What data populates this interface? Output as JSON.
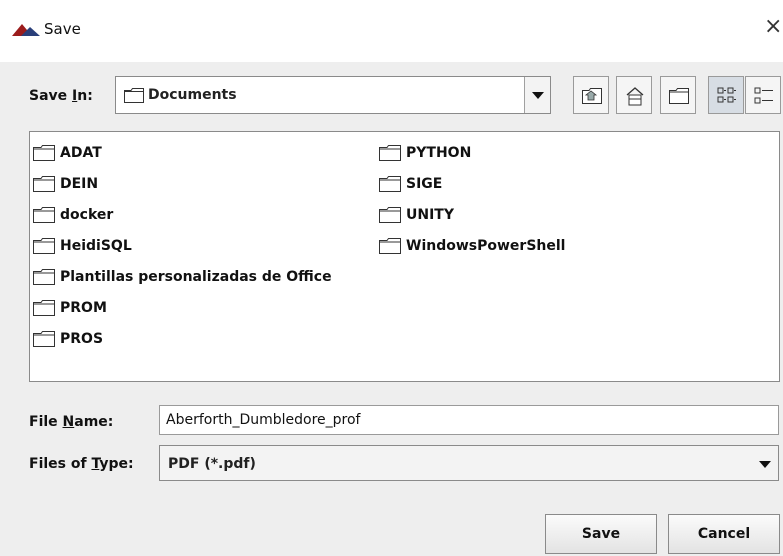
{
  "window": {
    "title": "Save",
    "close_glyph": "×",
    "icon": "java-cup-icon"
  },
  "save_in": {
    "label_prefix": "Save ",
    "label_mnemonic": "I",
    "label_suffix": "n:",
    "value": "Documents"
  },
  "toolbar": {
    "buttons": [
      "up-one-level",
      "home",
      "create-new-folder",
      "list-view",
      "details-view"
    ],
    "active": "list-view"
  },
  "files": {
    "column1": [
      "ADAT",
      "DEIN",
      "docker",
      "HeidiSQL",
      "Plantillas personalizadas de Office",
      "PROM",
      "PROS"
    ],
    "column2": [
      "PYTHON",
      "SIGE",
      "UNITY",
      "WindowsPowerShell"
    ]
  },
  "file_name": {
    "label_prefix": "File ",
    "label_mnemonic": "N",
    "label_suffix": "ame:",
    "value": "Aberforth_Dumbledore_prof"
  },
  "file_type": {
    "label_prefix": "Files of ",
    "label_mnemonic": "T",
    "label_suffix": "ype:",
    "value": "PDF (*.pdf)"
  },
  "buttons": {
    "save": "Save",
    "cancel": "Cancel"
  }
}
